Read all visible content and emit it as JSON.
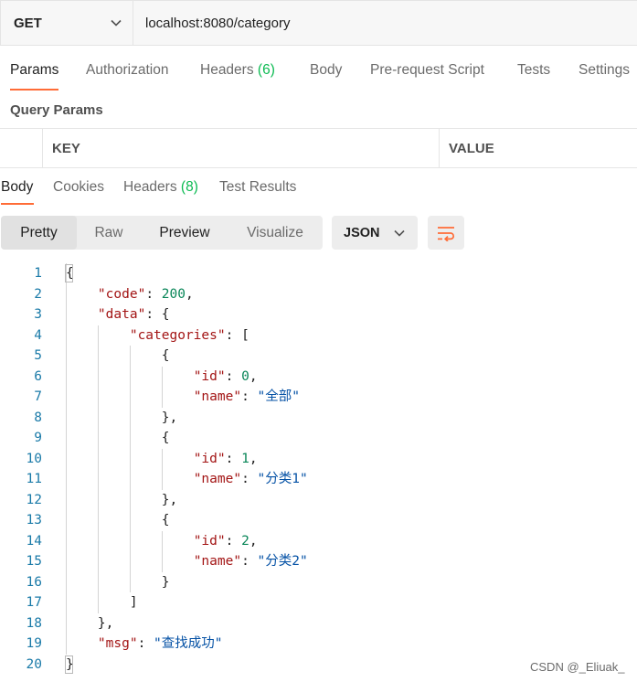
{
  "request": {
    "method": "GET",
    "url": "localhost:8080/category"
  },
  "request_tabs": [
    {
      "label": "Params",
      "active": true
    },
    {
      "label": "Authorization"
    },
    {
      "label": "Headers",
      "count": "(6)"
    },
    {
      "label": "Body"
    },
    {
      "label": "Pre-request Script"
    },
    {
      "label": "Tests"
    },
    {
      "label": "Settings"
    }
  ],
  "query_params": {
    "title": "Query Params",
    "columns": [
      "KEY",
      "VALUE"
    ]
  },
  "response_tabs": [
    {
      "label": "Body",
      "active": true
    },
    {
      "label": "Cookies"
    },
    {
      "label": "Headers",
      "count": "(8)"
    },
    {
      "label": "Test Results"
    }
  ],
  "view_modes": [
    "Pretty",
    "Raw",
    "Preview",
    "Visualize"
  ],
  "active_view": "Pretty",
  "format": "JSON",
  "code_lines": [
    {
      "n": "1",
      "t": "{"
    },
    {
      "n": "2",
      "t": "    \"code\": 200,"
    },
    {
      "n": "3",
      "t": "    \"data\": {"
    },
    {
      "n": "4",
      "t": "        \"categories\": ["
    },
    {
      "n": "5",
      "t": "            {"
    },
    {
      "n": "6",
      "t": "                \"id\": 0,"
    },
    {
      "n": "7",
      "t": "                \"name\": \"全部\""
    },
    {
      "n": "8",
      "t": "            },"
    },
    {
      "n": "9",
      "t": "            {"
    },
    {
      "n": "10",
      "t": "                \"id\": 1,"
    },
    {
      "n": "11",
      "t": "                \"name\": \"分类1\""
    },
    {
      "n": "12",
      "t": "            },"
    },
    {
      "n": "13",
      "t": "            {"
    },
    {
      "n": "14",
      "t": "                \"id\": 2,"
    },
    {
      "n": "15",
      "t": "                \"name\": \"分类2\""
    },
    {
      "n": "16",
      "t": "            }"
    },
    {
      "n": "17",
      "t": "        ]"
    },
    {
      "n": "18",
      "t": "    },"
    },
    {
      "n": "19",
      "t": "    \"msg\": \"查找成功\""
    },
    {
      "n": "20",
      "t": "}"
    }
  ],
  "watermark": "CSDN @_Eliuak_",
  "colors": {
    "accent": "#ff6c37",
    "count_green": "#0cbb52",
    "json_key": "#a31515",
    "json_string": "#0451a5",
    "json_number": "#098658",
    "line_number": "#1a7aa8"
  },
  "icons": {
    "method_dropdown": "chevron-down-icon",
    "format_dropdown": "chevron-down-icon",
    "wrap": "wrap-lines-icon"
  }
}
